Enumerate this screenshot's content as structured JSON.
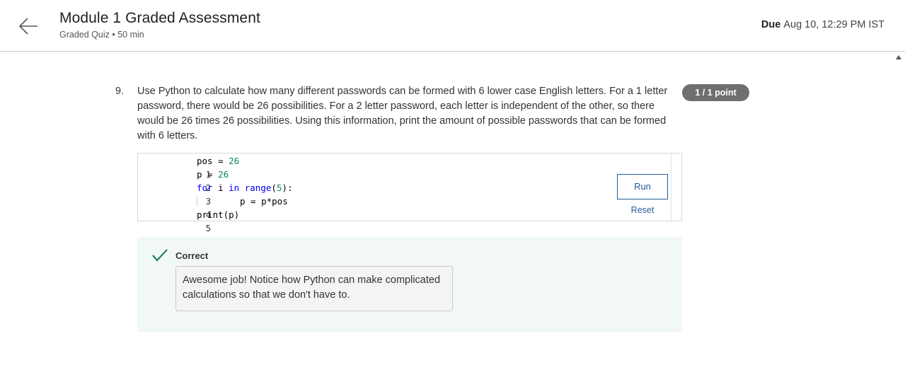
{
  "header": {
    "title": "Module 1 Graded Assessment",
    "subtitle": "Graded Quiz • 50 min",
    "due_label": "Due",
    "due_value": "Aug 10, 12:29 PM IST",
    "icons": {
      "back": "arrow-left-icon"
    }
  },
  "question": {
    "number": "9.",
    "text": "Use Python to calculate how many different passwords can be formed with 6 lower case English letters. For a 1 letter password, there would be 26 possibilities. For a 2 letter password, each letter is independent of the other, so there would be 26 times 26 possibilities. Using this information, print the amount of possible passwords that can be formed with 6 letters.",
    "points": "1 / 1 point"
  },
  "code": {
    "lines": [
      {
        "n": "1",
        "tokens": {
          "a": "pos",
          "b": " = ",
          "c": "26"
        }
      },
      {
        "n": "2",
        "tokens": {
          "a": "p",
          "b": " = ",
          "c": "26"
        }
      },
      {
        "n": "3",
        "tokens": {
          "kw1": "for",
          "a": " i ",
          "kw2": "in",
          "b": " ",
          "kw3": "range",
          "c": "(",
          "num": "5",
          "d": "):"
        }
      },
      {
        "n": "4",
        "text": "p = p*pos"
      },
      {
        "n": "5",
        "text": "print(p)"
      }
    ],
    "run_label": "Run",
    "reset_label": "Reset"
  },
  "feedback": {
    "status": "Correct",
    "message": "Awesome job!  Notice how Python can make complicated calculations so that we don't have to.",
    "icons": {
      "status": "checkmark-icon"
    },
    "colors": {
      "check": "#1f8354",
      "background": "#f2f8f5"
    }
  },
  "colors": {
    "link": "#1f5c99",
    "badge": "#6f6f6f"
  }
}
